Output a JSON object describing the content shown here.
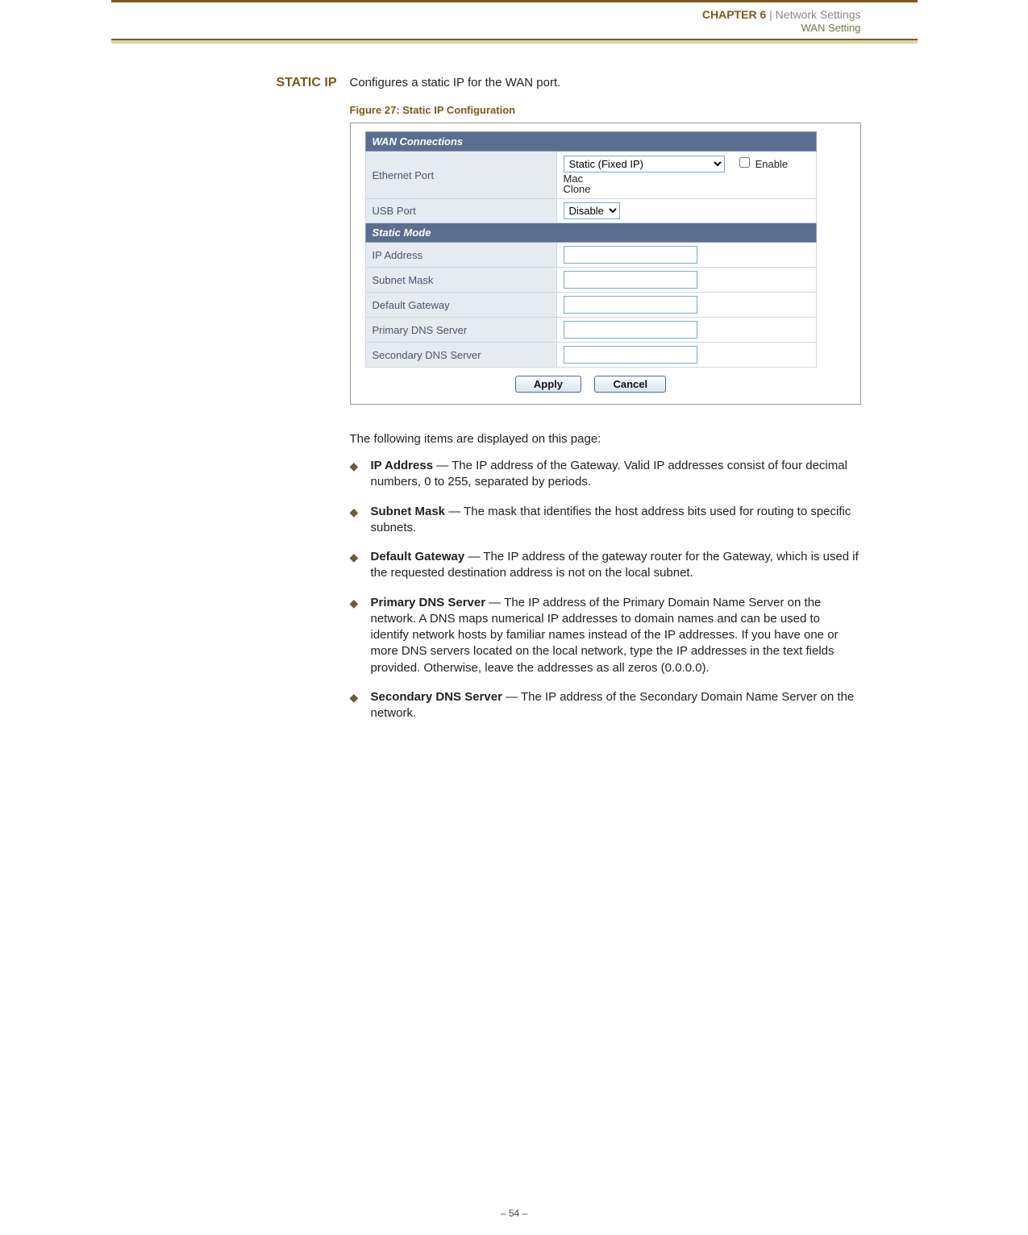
{
  "header": {
    "chapter": "CHAPTER 6",
    "separator": "|",
    "title": "Network Settings",
    "subtitle": "WAN Setting"
  },
  "margin_label_sc": "S",
  "margin_label_rest": "TATIC IP",
  "lead": "Configures a static IP for the WAN port.",
  "figure_caption": "Figure 27:  Static IP Configuration",
  "panel": {
    "section1": "WAN Connections",
    "row_eth_label": "Ethernet Port",
    "eth_select": "Static (Fixed IP)",
    "eth_clone_word": "Clone",
    "eth_checkbox_label": "Enable Mac",
    "row_usb_label": "USB Port",
    "usb_select": "Disable",
    "section2": "Static Mode",
    "rows": {
      "ip": "IP Address",
      "mask": "Subnet Mask",
      "gw": "Default Gateway",
      "dns1": "Primary DNS Server",
      "dns2": "Secondary DNS Server"
    },
    "btn_apply": "Apply",
    "btn_cancel": "Cancel"
  },
  "after_fig_intro": "The following items are displayed on this page:",
  "bullets": {
    "b1_term": "IP Address",
    "b1_rest": " — The IP address of the Gateway. Valid IP addresses consist of four decimal numbers, 0 to 255, separated by periods.",
    "b2_term": "Subnet Mask",
    "b2_rest": " — The mask that identifies the host address bits used for routing to specific subnets.",
    "b3_term": "Default Gateway",
    "b3_rest": " — The IP address of the gateway router for the Gateway, which is used if the requested destination address is not on the local subnet.",
    "b4_term": "Primary DNS Server",
    "b4_rest": " — The IP address of the Primary Domain Name Server on the network. A DNS maps numerical IP addresses to domain names and can be used to identify network hosts by familiar names instead of the IP addresses. If you have one or more DNS servers located on the local network, type the IP addresses in the text fields provided. Otherwise, leave the addresses as all zeros (0.0.0.0).",
    "b5_term": "Secondary DNS Server",
    "b5_rest": " — The IP address of the Secondary Domain Name Server on the network."
  },
  "page_number": "–  54  –"
}
